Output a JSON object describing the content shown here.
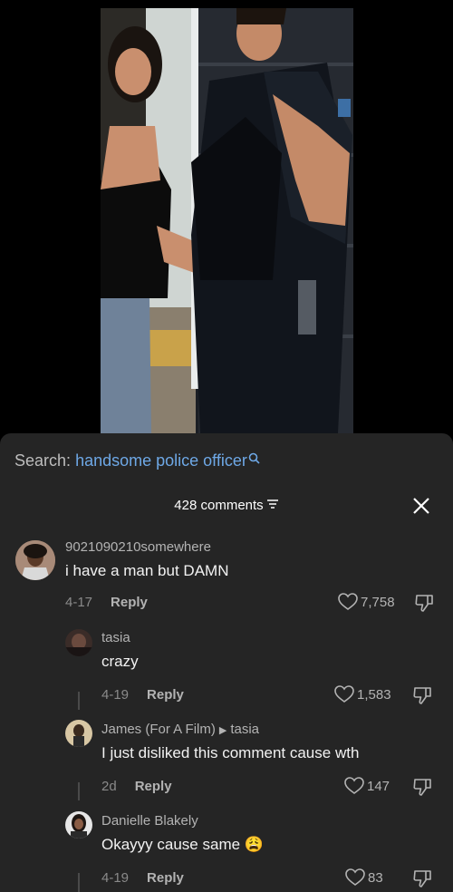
{
  "search": {
    "label": "Search:",
    "term": "handsome police officer"
  },
  "header": {
    "comment_count": "428 comments"
  },
  "comments": [
    {
      "username": "9021090210somewhere",
      "text": "i have a man but DAMN",
      "date": "4-17",
      "reply_label": "Reply",
      "likes": "7,758"
    },
    {
      "username": "tasia",
      "text": "crazy",
      "date": "4-19",
      "reply_label": "Reply",
      "likes": "1,583"
    },
    {
      "username": "James (For A Film)",
      "reply_to": "tasia",
      "text": "I just disliked this comment cause wth",
      "date": "2d",
      "reply_label": "Reply",
      "likes": "147"
    },
    {
      "username": "Danielle Blakely",
      "text": "Okayyy cause same",
      "emoji": "😩",
      "date": "4-19",
      "reply_label": "Reply",
      "likes": "83"
    }
  ]
}
